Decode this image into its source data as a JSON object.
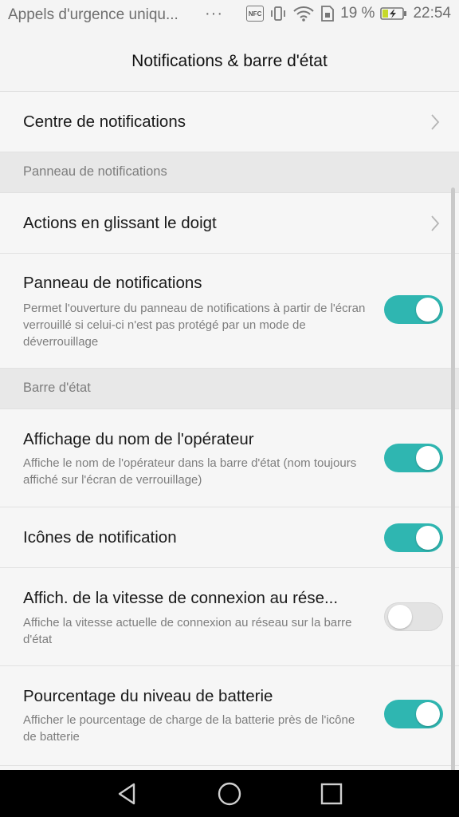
{
  "status_bar": {
    "carrier": "Appels d'urgence uniqu...",
    "more": "···",
    "nfc": "NFC",
    "battery_percent": "19 %",
    "time": "22:54",
    "icons": [
      "nfc-icon",
      "vibrate-icon",
      "wifi-icon",
      "sim-icon",
      "battery-charging-icon"
    ]
  },
  "header": {
    "title": "Notifications & barre d'état"
  },
  "items": {
    "notification_center": {
      "title": "Centre de notifications"
    },
    "section_panel": {
      "label": "Panneau de notifications"
    },
    "swipe_actions": {
      "title": "Actions en glissant le doigt"
    },
    "panel": {
      "title": "Panneau de notifications",
      "subtitle": "Permet l'ouverture du panneau de notifications à partir de l'écran verrouillé si celui-ci n'est pas protégé par un mode de déverrouillage",
      "enabled": true
    },
    "section_statusbar": {
      "label": "Barre d'état"
    },
    "carrier_name": {
      "title": "Affichage du nom de l'opérateur",
      "subtitle": "Affiche le nom de l'opérateur dans la barre d'état (nom toujours affiché sur l'écran de verrouillage)",
      "enabled": true
    },
    "notif_icons": {
      "title": "Icônes de notification",
      "enabled": true
    },
    "net_speed": {
      "title": "Affich. de la vitesse de connexion au rése...",
      "subtitle": "Affiche la vitesse actuelle de connexion au réseau sur la barre d'état",
      "enabled": false
    },
    "battery_pct": {
      "title": "Pourcentage du niveau de batterie",
      "subtitle": "Afficher le pourcentage de charge de la batterie près de l'icône de batterie",
      "enabled": true
    }
  },
  "nav": {
    "icons": [
      "back-icon",
      "home-icon",
      "recents-icon"
    ]
  },
  "colors": {
    "accent": "#2fb6b1",
    "background": "#f6f6f6",
    "section": "#e8e8e8"
  }
}
